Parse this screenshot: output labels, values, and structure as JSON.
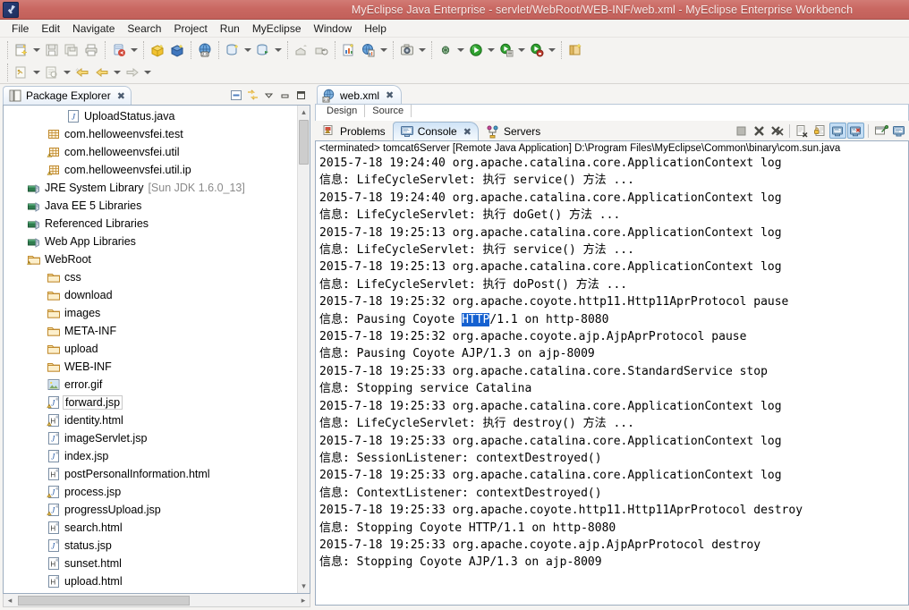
{
  "window": {
    "title": "MyEclipse Java Enterprise - servlet/WebRoot/WEB-INF/web.xml - MyEclipse Enterprise Workbench",
    "app_icon": "myeclipse-icon",
    "titlebar_color": "#c96862"
  },
  "menubar": {
    "items": [
      {
        "label": "File"
      },
      {
        "label": "Edit"
      },
      {
        "label": "Navigate"
      },
      {
        "label": "Search"
      },
      {
        "label": "Project"
      },
      {
        "label": "Run"
      },
      {
        "label": "MyEclipse"
      },
      {
        "label": "Window"
      },
      {
        "label": "Help"
      }
    ]
  },
  "toolbar": {
    "row1": [
      {
        "name": "new-wizard-button",
        "icon": "new-file-icon",
        "dropdown": true
      },
      {
        "name": "save-button",
        "icon": "save-icon",
        "dropdown": false
      },
      {
        "name": "save-all-button",
        "icon": "save-all-icon",
        "dropdown": false
      },
      {
        "name": "print-button",
        "icon": "print-icon",
        "dropdown": false
      },
      {
        "name": "new-deployment-button",
        "icon": "deploy-icon",
        "dropdown": true
      },
      {
        "name": "new-package-button",
        "icon": "package-yellow-icon",
        "dropdown": false
      },
      {
        "name": "new-class-button",
        "icon": "package-blue-icon",
        "dropdown": false
      },
      {
        "name": "web-browser-button",
        "icon": "globe-2.0-icon",
        "dropdown": false
      },
      {
        "name": "new-db-connection-button",
        "icon": "db-new-icon",
        "dropdown": true
      },
      {
        "name": "open-db-browser-button",
        "icon": "db-browser-icon",
        "dropdown": true
      },
      {
        "name": "new-xml-button",
        "icon": "xml-doc-icon",
        "dropdown": false
      },
      {
        "name": "run-xdoclet-button",
        "icon": "xdoclet-icon",
        "dropdown": true
      },
      {
        "name": "open-browser-button",
        "icon": "globe-icon",
        "dropdown": false
      },
      {
        "name": "export-button",
        "icon": "export-icon",
        "dropdown": false
      },
      {
        "name": "import-button",
        "icon": "import-icon",
        "dropdown": false
      },
      {
        "name": "report-button",
        "icon": "report-icon",
        "dropdown": false
      },
      {
        "name": "web-report-button",
        "icon": "web-report-icon",
        "dropdown": true
      },
      {
        "name": "snapshot-button",
        "icon": "camera-icon",
        "dropdown": true
      },
      {
        "name": "debug-button",
        "icon": "debug-bug-icon",
        "dropdown": true
      },
      {
        "name": "run-button",
        "icon": "run-green-icon",
        "dropdown": true
      },
      {
        "name": "run-history-button",
        "icon": "run-history-icon",
        "dropdown": true
      },
      {
        "name": "run-server-button",
        "icon": "run-server-icon",
        "dropdown": true
      },
      {
        "name": "open-perspective-button",
        "icon": "perspective-icon",
        "dropdown": false
      }
    ],
    "row2": [
      {
        "name": "open-type-button",
        "icon": "open-type-icon",
        "dropdown": true
      },
      {
        "name": "search-button",
        "icon": "search-doc-icon",
        "dropdown": true
      },
      {
        "name": "next-annotation-button",
        "icon": "next-annotation-icon",
        "dropdown": false
      },
      {
        "name": "back-button",
        "icon": "back-arrow-icon",
        "dropdown": true
      },
      {
        "name": "forward-button",
        "icon": "forward-arrow-icon",
        "dropdown": true
      }
    ]
  },
  "package_explorer": {
    "tab_label": "Package Explorer",
    "tab_icon": "package-explorer-icon",
    "close_icon": "close-icon",
    "tools": [
      {
        "name": "collapse-all-button",
        "icon": "collapse-all-icon"
      },
      {
        "name": "link-with-editor-button",
        "icon": "link-editor-icon"
      },
      {
        "name": "view-menu-button",
        "icon": "chevron-down-icon"
      },
      {
        "name": "minimize-button",
        "icon": "minimize-icon"
      },
      {
        "name": "maximize-button",
        "icon": "maximize-icon"
      }
    ],
    "tree": [
      {
        "label": "UploadStatus.java",
        "icon": "java-file-icon",
        "indent": 3,
        "selected": false
      },
      {
        "label": "com.helloweenvsfei.test",
        "icon": "package-icon",
        "indent": 2,
        "selected": false
      },
      {
        "label": "com.helloweenvsfei.util",
        "icon": "package-warn-icon",
        "indent": 2,
        "selected": false
      },
      {
        "label": "com.helloweenvsfei.util.ip",
        "icon": "package-warn-icon",
        "indent": 2,
        "selected": false
      },
      {
        "label": "JRE System Library",
        "suffix": "[Sun JDK 1.6.0_13]",
        "icon": "library-icon",
        "indent": 1,
        "selected": false
      },
      {
        "label": "Java EE 5 Libraries",
        "icon": "library-icon",
        "indent": 1,
        "selected": false
      },
      {
        "label": "Referenced Libraries",
        "icon": "library-icon",
        "indent": 1,
        "selected": false
      },
      {
        "label": "Web App Libraries",
        "icon": "library-icon",
        "indent": 1,
        "selected": false
      },
      {
        "label": "WebRoot",
        "icon": "webroot-folder-icon",
        "indent": 1,
        "selected": false
      },
      {
        "label": "css",
        "icon": "folder-icon",
        "indent": 2,
        "selected": false
      },
      {
        "label": "download",
        "icon": "folder-icon",
        "indent": 2,
        "selected": false
      },
      {
        "label": "images",
        "icon": "folder-icon",
        "indent": 2,
        "selected": false
      },
      {
        "label": "META-INF",
        "icon": "folder-icon",
        "indent": 2,
        "selected": false
      },
      {
        "label": "upload",
        "icon": "folder-icon",
        "indent": 2,
        "selected": false
      },
      {
        "label": "WEB-INF",
        "icon": "folder-icon",
        "indent": 2,
        "selected": false
      },
      {
        "label": "error.gif",
        "icon": "image-file-icon",
        "indent": 2,
        "selected": false
      },
      {
        "label": "forward.jsp",
        "icon": "jsp-warn-icon",
        "indent": 2,
        "selected": true
      },
      {
        "label": "identity.html",
        "icon": "html-warn-icon",
        "indent": 2,
        "selected": false
      },
      {
        "label": "imageServlet.jsp",
        "icon": "jsp-icon",
        "indent": 2,
        "selected": false
      },
      {
        "label": "index.jsp",
        "icon": "jsp-icon",
        "indent": 2,
        "selected": false
      },
      {
        "label": "postPersonalInformation.html",
        "icon": "html-icon",
        "indent": 2,
        "selected": false
      },
      {
        "label": "process.jsp",
        "icon": "jsp-warn-icon",
        "indent": 2,
        "selected": false
      },
      {
        "label": "progressUpload.jsp",
        "icon": "jsp-warn-icon",
        "indent": 2,
        "selected": false
      },
      {
        "label": "search.html",
        "icon": "html-icon",
        "indent": 2,
        "selected": false
      },
      {
        "label": "status.jsp",
        "icon": "jsp-icon",
        "indent": 2,
        "selected": false
      },
      {
        "label": "sunset.html",
        "icon": "html-icon",
        "indent": 2,
        "selected": false
      },
      {
        "label": "upload.html",
        "icon": "html-icon",
        "indent": 2,
        "selected": false
      }
    ]
  },
  "editor": {
    "tab_label": "web.xml",
    "tab_icon": "xml-2.5-icon",
    "close_icon": "close-icon",
    "design_source_tabs": [
      {
        "label": "Design"
      },
      {
        "label": "Source"
      }
    ]
  },
  "console": {
    "tabs": [
      {
        "label": "Problems",
        "icon": "problems-icon",
        "active": false
      },
      {
        "label": "Console",
        "icon": "console-icon",
        "active": true,
        "close_icon": "close-icon"
      },
      {
        "label": "Servers",
        "icon": "servers-icon",
        "active": false
      }
    ],
    "tools": [
      {
        "name": "terminate-button",
        "icon": "terminate-square-icon",
        "pressed": false
      },
      {
        "name": "remove-launch-button",
        "icon": "remove-launch-icon",
        "pressed": false
      },
      {
        "name": "remove-all-terminated-button",
        "icon": "remove-all-launches-icon",
        "pressed": false
      },
      {
        "name": "clear-console-button",
        "icon": "clear-console-icon",
        "pressed": false
      },
      {
        "name": "scroll-lock-button",
        "icon": "scroll-lock-icon",
        "pressed": false
      },
      {
        "name": "show-console-on-output-button",
        "icon": "show-console-stdout-icon",
        "pressed": true
      },
      {
        "name": "show-console-on-error-button",
        "icon": "show-console-stderr-icon",
        "pressed": true
      },
      {
        "name": "pin-console-button",
        "icon": "pin-console-icon",
        "pressed": false
      },
      {
        "name": "display-selected-console-button",
        "icon": "display-console-icon",
        "pressed": false
      }
    ],
    "header": "<terminated> tomcat6Server [Remote Java Application] D:\\Program Files\\MyEclipse\\Common\\binary\\com.sun.java",
    "lines": [
      "2015-7-18 19:24:40 org.apache.catalina.core.ApplicationContext log",
      "信息: LifeCycleServlet: 执行 service() 方法 ...",
      "2015-7-18 19:24:40 org.apache.catalina.core.ApplicationContext log",
      "信息: LifeCycleServlet: 执行 doGet() 方法 ...",
      "2015-7-18 19:25:13 org.apache.catalina.core.ApplicationContext log",
      "信息: LifeCycleServlet: 执行 service() 方法 ...",
      "2015-7-18 19:25:13 org.apache.catalina.core.ApplicationContext log",
      "信息: LifeCycleServlet: 执行 doPost() 方法 ...",
      "2015-7-18 19:25:32 org.apache.coyote.http11.Http11AprProtocol pause",
      "信息: Pausing Coyote HTTP/1.1 on http-8080",
      "2015-7-18 19:25:32 org.apache.coyote.ajp.AjpAprProtocol pause",
      "信息: Pausing Coyote AJP/1.3 on ajp-8009",
      "2015-7-18 19:25:33 org.apache.catalina.core.StandardService stop",
      "信息: Stopping service Catalina",
      "2015-7-18 19:25:33 org.apache.catalina.core.ApplicationContext log",
      "信息: LifeCycleServlet: 执行 destroy() 方法 ...",
      "2015-7-18 19:25:33 org.apache.catalina.core.ApplicationContext log",
      "信息: SessionListener: contextDestroyed()",
      "2015-7-18 19:25:33 org.apache.catalina.core.ApplicationContext log",
      "信息: ContextListener: contextDestroyed()",
      "2015-7-18 19:25:33 org.apache.coyote.http11.Http11AprProtocol destroy",
      "信息: Stopping Coyote HTTP/1.1 on http-8080",
      "2015-7-18 19:25:33 org.apache.coyote.ajp.AjpAprProtocol destroy",
      "信息: Stopping Coyote AJP/1.3 on ajp-8009"
    ],
    "selection": {
      "line_index": 9,
      "text": "HTTP",
      "prefix": "信息: Pausing Coyote ",
      "suffix": "/1.1 on http-8080",
      "color": "#1460d0"
    }
  }
}
